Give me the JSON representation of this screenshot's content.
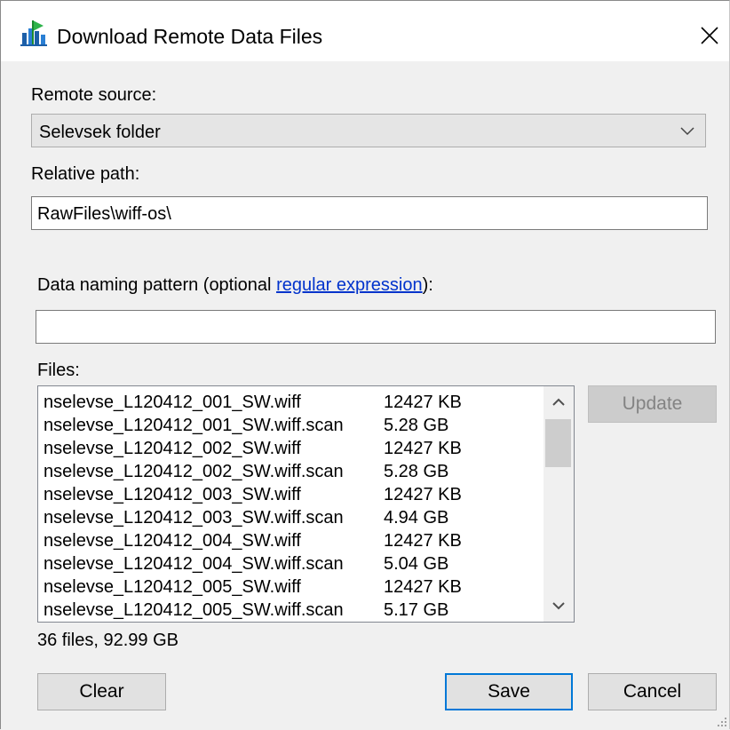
{
  "window": {
    "title": "Download Remote Data Files",
    "icon": "skyline-app-icon",
    "close_icon": "close-icon"
  },
  "remote_source": {
    "label": "Remote source:",
    "selected": "Selevsek folder"
  },
  "relative_path": {
    "label": "Relative path:",
    "value": "RawFiles\\wiff-os\\"
  },
  "naming_pattern": {
    "label_prefix": "Data naming pattern (optional ",
    "link_text": "regular expression",
    "label_suffix": "):",
    "value": ""
  },
  "files": {
    "label": "Files:",
    "items": [
      {
        "name": "nselevse_L120412_001_SW.wiff",
        "size": "12427 KB"
      },
      {
        "name": "nselevse_L120412_001_SW.wiff.scan",
        "size": "5.28 GB"
      },
      {
        "name": "nselevse_L120412_002_SW.wiff",
        "size": "12427 KB"
      },
      {
        "name": "nselevse_L120412_002_SW.wiff.scan",
        "size": "5.28 GB"
      },
      {
        "name": "nselevse_L120412_003_SW.wiff",
        "size": "12427 KB"
      },
      {
        "name": "nselevse_L120412_003_SW.wiff.scan",
        "size": "4.94 GB"
      },
      {
        "name": "nselevse_L120412_004_SW.wiff",
        "size": "12427 KB"
      },
      {
        "name": "nselevse_L120412_004_SW.wiff.scan",
        "size": "5.04 GB"
      },
      {
        "name": "nselevse_L120412_005_SW.wiff",
        "size": "12427 KB"
      },
      {
        "name": "nselevse_L120412_005_SW.wiff.scan",
        "size": "5.17 GB"
      }
    ],
    "summary": "36 files, 92.99 GB"
  },
  "buttons": {
    "update": "Update",
    "clear": "Clear",
    "save": "Save",
    "cancel": "Cancel"
  },
  "colors": {
    "accent": "#0078d7",
    "link": "#0033cc",
    "background": "#f0f0f0"
  }
}
